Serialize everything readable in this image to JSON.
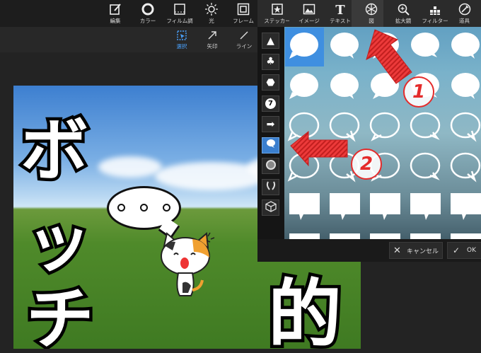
{
  "toolbar": {
    "items": [
      {
        "label": "編集",
        "icon": "edit-icon"
      },
      {
        "label": "カラー",
        "icon": "color-ring-icon"
      },
      {
        "label": "フィルム調",
        "icon": "film-icon"
      },
      {
        "label": "光",
        "icon": "sun-icon"
      },
      {
        "label": "フレーム",
        "icon": "frame-icon"
      },
      {
        "label": "ステッカー",
        "icon": "sticker-icon"
      },
      {
        "label": "イメージ",
        "icon": "image-icon"
      },
      {
        "label": "テキスト",
        "icon": "text-t-icon"
      },
      {
        "label": "図",
        "icon": "shape-icon"
      },
      {
        "label": "拡大鏡",
        "icon": "magnifier-icon"
      },
      {
        "label": "フィルター",
        "icon": "filter-grid-icon"
      },
      {
        "label": "道具",
        "icon": "tools-icon"
      }
    ]
  },
  "subbar": {
    "items": [
      {
        "label": "選択",
        "icon": "select-icon"
      },
      {
        "label": "矢印",
        "icon": "arrow-icon"
      },
      {
        "label": "ライン",
        "icon": "line-icon"
      }
    ]
  },
  "canvas": {
    "text_vertical": [
      "ボ",
      "ッ",
      "チ"
    ],
    "text_right": "的"
  },
  "shape_categories": [
    {
      "icon": "triangle-icon",
      "glyph": "▲"
    },
    {
      "icon": "club-icon",
      "glyph": "♣"
    },
    {
      "icon": "badge-icon",
      "glyph": "⬣"
    },
    {
      "icon": "number-badge-icon",
      "glyph": "7"
    },
    {
      "icon": "arrow-right-icon",
      "glyph": "➡"
    },
    {
      "icon": "speech-bubble-icon",
      "glyph": ""
    },
    {
      "icon": "starburst-icon",
      "glyph": ""
    },
    {
      "icon": "laurel-icon",
      "glyph": ""
    },
    {
      "icon": "cube-icon",
      "glyph": ""
    }
  ],
  "annotations": {
    "one": "1",
    "two": "2"
  },
  "footer": {
    "cancel_label": "キャンセル",
    "ok_label": "OK"
  },
  "colors": {
    "accent": "#3f8fe0",
    "arrow_red": "#e42b2b"
  }
}
